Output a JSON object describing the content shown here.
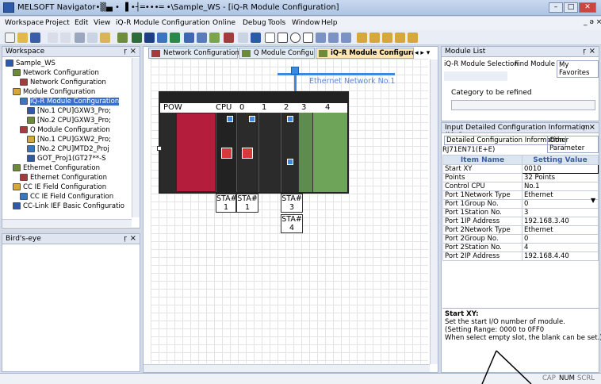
{
  "window": {
    "title": "MELSOFT Navigator•▒▄ • ▐ •┤═•••═ •\\Sample_WS - [iQ-R Module Configuration]",
    "min": "–",
    "max": "□",
    "close": "✕",
    "doc_controls": "_ ə ×"
  },
  "menu": [
    "Workspace",
    "Project",
    "Edit",
    "View",
    "iQ-R Module Configuration",
    "Online",
    "Debug",
    "Tools",
    "Window",
    "Help"
  ],
  "workspace": {
    "title": "Workspace",
    "pin": "ṛ",
    "close": "×",
    "tree": [
      {
        "label": "Sample_WS",
        "level": 0
      },
      {
        "label": "Network Configuration",
        "level": 1
      },
      {
        "label": "Network Configuration",
        "level": 2
      },
      {
        "label": "Module Configuration",
        "level": 1
      },
      {
        "label": "iQ-R Module Configuration",
        "level": 2
      },
      {
        "label": "[No.1 CPU]GXW3_Pro;",
        "level": 3
      },
      {
        "label": "[No.2 CPU]GXW3_Pro;",
        "level": 3
      },
      {
        "label": "Q Module Configuration",
        "level": 2
      },
      {
        "label": "[No.1 CPU]GXW2_Pro;",
        "level": 3
      },
      {
        "label": "[No.2 CPU]MTD2_Proj",
        "level": 3
      },
      {
        "label": "GOT_Proj1(GT27**-S",
        "level": 3
      },
      {
        "label": "Ethernet Configuration",
        "level": 1
      },
      {
        "label": "Ethernet Configuration",
        "level": 2
      },
      {
        "label": "CC IE Field Configuration",
        "level": 1
      },
      {
        "label": "CC IE Field Configuration",
        "level": 2
      },
      {
        "label": "CC-Link IEF Basic Configuratio",
        "level": 1
      }
    ]
  },
  "birdseye": {
    "title": "Bird's-eye",
    "pin": "ṛ",
    "close": "×"
  },
  "tabs": [
    {
      "label": "Network Configuration",
      "active": false
    },
    {
      "label": "Q Module Configuration",
      "active": false
    },
    {
      "label": "iQ-R Module Configuratic",
      "active": true
    }
  ],
  "tab_nav": "◂ ▸ ▾",
  "canvas": {
    "network_label": "Ethernet Network No.1",
    "slot_labels": [
      "POW",
      "CPU",
      "0",
      "1",
      "2",
      "3",
      "4"
    ],
    "sta": [
      {
        "line1": "STA#",
        "line2": "1"
      },
      {
        "line1": "STA#",
        "line2": "1"
      },
      {
        "line1": "STA#",
        "line2": "3"
      },
      {
        "line1": "STA#",
        "line2": "4"
      }
    ]
  },
  "module_list": {
    "title": "Module List",
    "pin": "ṛ",
    "close": "×",
    "tabs": [
      "iQ-R Module Selection",
      "Find Module",
      "My Favorites"
    ],
    "category_label": "Category to be refined"
  },
  "input_info": {
    "title": "Input Detailed Configuration Information (iQ C...",
    "pin": "ṛ",
    "close": "×",
    "tabs": [
      "Detailed Configuration Information",
      "Other Parameter"
    ],
    "module": "RJ71EN71(E+E)",
    "headers": [
      "Item Name",
      "Setting Value"
    ],
    "rows": [
      [
        "Start XY",
        "0010"
      ],
      [
        "Points",
        "32 Points"
      ],
      [
        "Control CPU",
        "No.1"
      ],
      [
        "Port 1Network Type",
        "Ethernet"
      ],
      [
        "Port 1Group No.",
        "0"
      ],
      [
        "Port 1Station No.",
        "3"
      ],
      [
        "Port 1IP Address",
        "192.168.3.40"
      ],
      [
        "Port 2Network Type",
        "Ethernet"
      ],
      [
        "Port 2Group No.",
        "0"
      ],
      [
        "Port 2Station No.",
        "4"
      ],
      [
        "Port 2IP Address",
        "192.168.4.40"
      ]
    ],
    "help_title": "Start XY:",
    "help_lines": [
      "Set the start I/O number of module.",
      "(Setting Range: 0000 to 0FF0",
      "When select empty slot, the blank can be set.)"
    ]
  },
  "status": {
    "cap": "CAP",
    "num": "NUM",
    "scrl": "SCRL"
  }
}
